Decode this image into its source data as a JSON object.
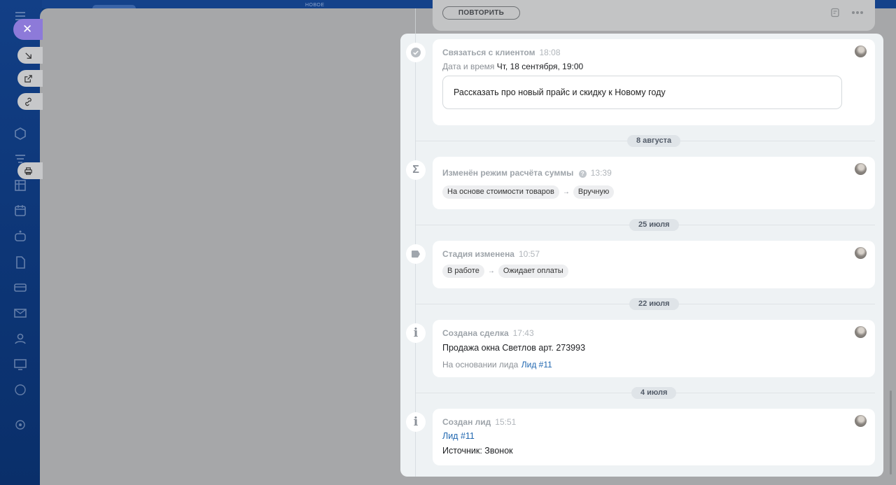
{
  "topbar": {
    "label": "НОВОЕ"
  },
  "repeat_card": {
    "button_label": "ПОВТОРИТЬ"
  },
  "timeline": {
    "task": {
      "title": "Связаться с клиентом",
      "time": "18:08",
      "date_label": "Дата и время",
      "date_value": "Чт, 18 сентября, 19:00",
      "comment": "Рассказать про новый прайс и скидку к Новому году"
    },
    "date1": "8 августа",
    "sum_mode": {
      "title": "Изменён режим расчёта суммы",
      "time": "13:39",
      "from": "На основе стоимости товаров",
      "to": "Вручную"
    },
    "date2": "25 июля",
    "stage": {
      "title": "Стадия изменена",
      "time": "10:57",
      "from": "В работе",
      "to": "Ожидает оплаты"
    },
    "date3": "22 июля",
    "deal": {
      "title": "Создана сделка",
      "time": "17:43",
      "name": "Продажа окна Светлов арт. 273993",
      "basis_label": "На основании лида",
      "basis_link": "Лид #11"
    },
    "date4": "4 июля",
    "lead": {
      "title": "Создан лид",
      "time": "15:51",
      "link": "Лид #11",
      "source": "Источник: Звонок"
    }
  },
  "colors": {
    "accent": "#8d7ad9",
    "link": "#2067b0",
    "panel_bg": "#eef2f4"
  }
}
